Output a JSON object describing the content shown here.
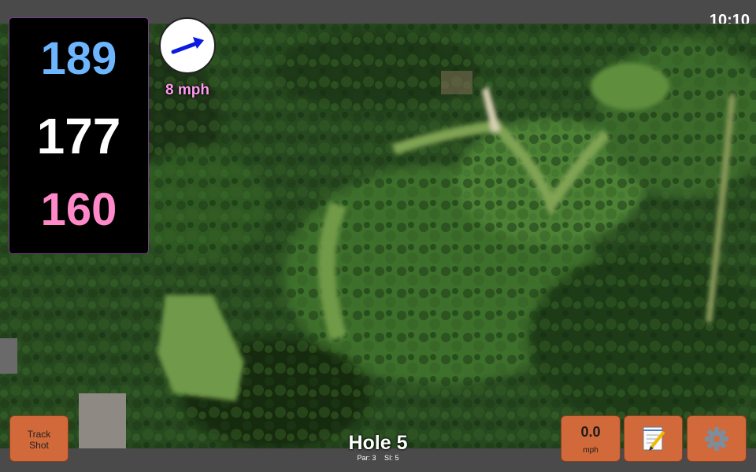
{
  "status_bar": {
    "time": "10:10"
  },
  "distances": {
    "back": "189",
    "middle": "177",
    "front": "160"
  },
  "wind": {
    "speed": "8 mph",
    "icon": "arrow-icon"
  },
  "hole": {
    "title": "Hole 5",
    "par_label": "Par: 3",
    "si_label": "SI: 5"
  },
  "buttons": {
    "track_shot_line1": "Track",
    "track_shot_line2": "Shot",
    "speed_value": "0.0",
    "speed_unit": "mph",
    "notes_icon": "notepad-icon",
    "settings_icon": "gear-icon"
  },
  "colors": {
    "back": "#6db6ff",
    "middle": "#ffffff",
    "front": "#ff88c8",
    "button": "#d2693a",
    "wind_text": "#ff9cf0"
  }
}
